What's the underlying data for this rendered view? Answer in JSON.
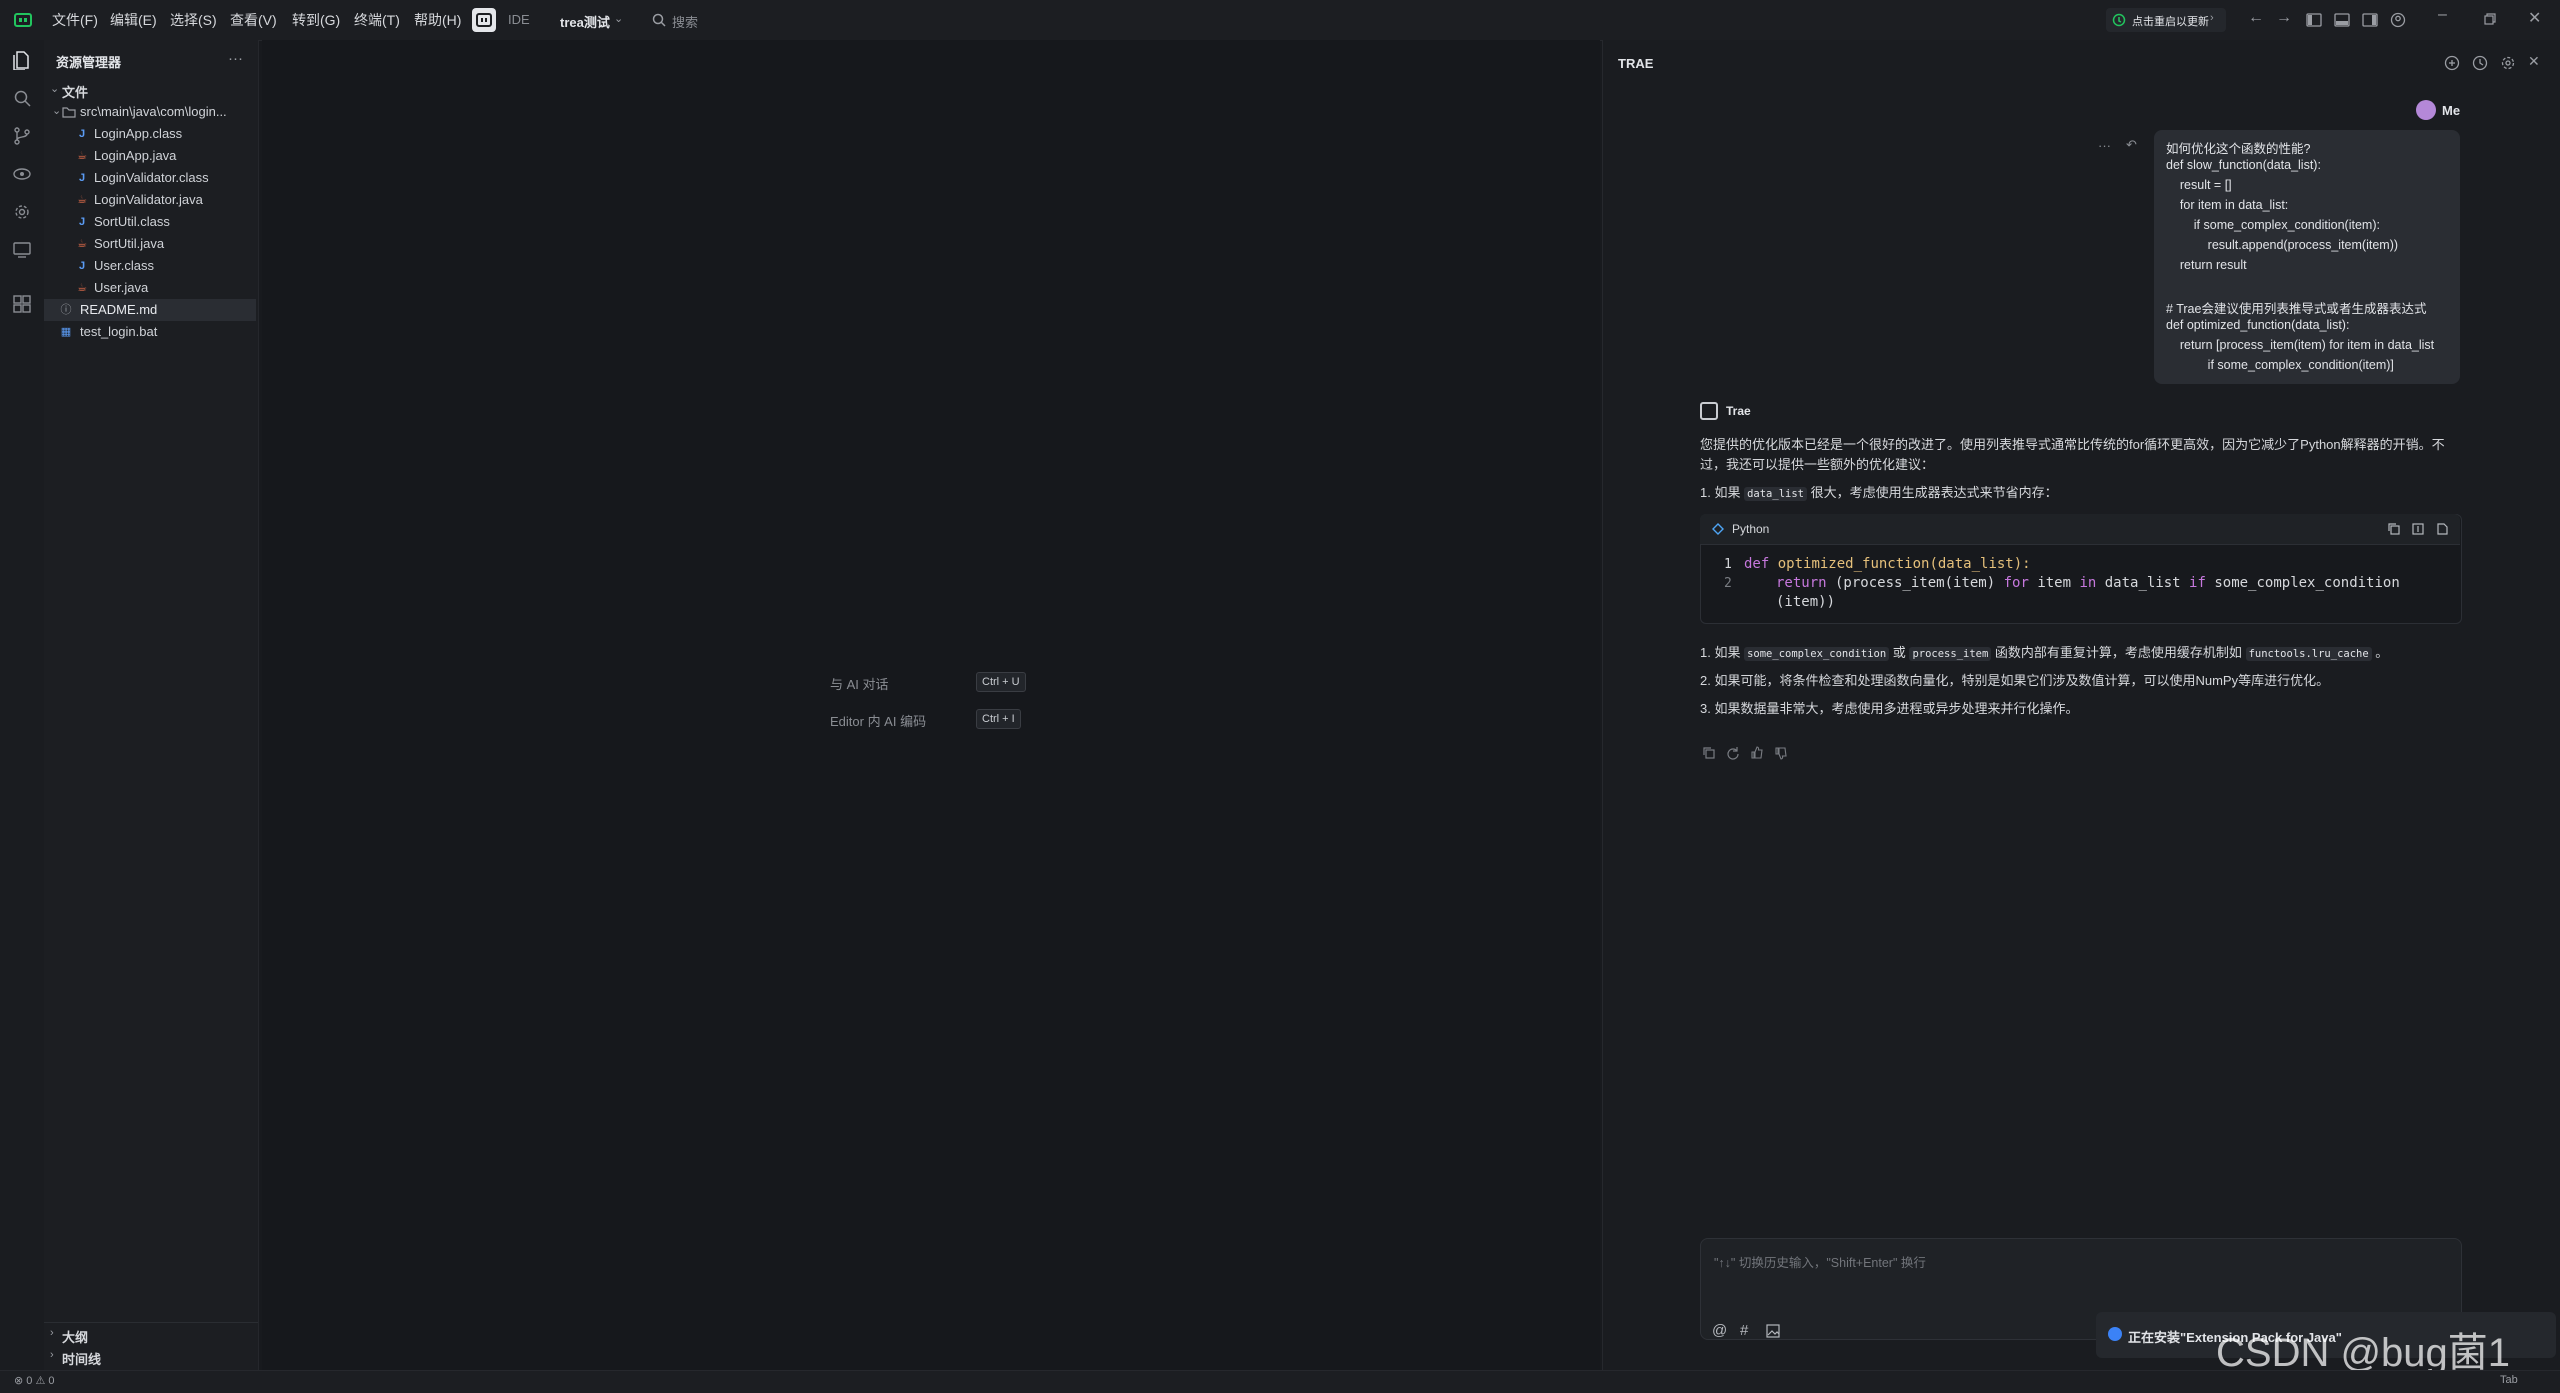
{
  "menu": {
    "items": [
      "文件(F)",
      "编辑(E)",
      "选择(S)",
      "查看(V)",
      "转到(G)",
      "终端(T)",
      "帮助(H)"
    ],
    "ide_label": "IDE",
    "project_name": "trea测试",
    "search_label": "搜索",
    "update_button": "点击重启以更新"
  },
  "sidebar": {
    "title": "资源管理器",
    "section_files": "文件",
    "folder_path": "src\\main\\java\\com\\login...",
    "files": [
      {
        "name": "LoginApp.class",
        "icon": "java-class-icon"
      },
      {
        "name": "LoginApp.java",
        "icon": "java-file-icon"
      },
      {
        "name": "LoginValidator.class",
        "icon": "java-class-icon"
      },
      {
        "name": "LoginValidator.java",
        "icon": "java-file-icon"
      },
      {
        "name": "SortUtil.class",
        "icon": "java-class-icon"
      },
      {
        "name": "SortUtil.java",
        "icon": "java-file-icon"
      },
      {
        "name": "User.class",
        "icon": "java-class-icon"
      },
      {
        "name": "User.java",
        "icon": "java-file-icon"
      }
    ],
    "root_files": [
      {
        "name": "README.md",
        "icon": "info-icon",
        "selected": true
      },
      {
        "name": "test_login.bat",
        "icon": "bat-file-icon",
        "selected": false
      }
    ],
    "section_outline": "大纲",
    "section_timeline": "时间线"
  },
  "editor": {
    "hints": [
      {
        "label": "与 AI 对话",
        "key1": "Ctrl",
        "plus": "+",
        "key2": "U"
      },
      {
        "label": "Editor 内 AI 编码",
        "key1": "Ctrl",
        "plus": "+",
        "key2": "I"
      }
    ]
  },
  "ai_panel": {
    "title": "TRAE",
    "user_name": "Me",
    "user_message_lines": [
      "如何优化这个函数的性能?",
      "def slow_function(data_list):",
      "    result = []",
      "    for item in data_list:",
      "        if some_complex_condition(item):",
      "            result.append(process_item(item))",
      "    return result",
      "",
      "# Trae会建议使用列表推导式或者生成器表达式",
      "def optimized_function(data_list):",
      "    return [process_item(item) for item in data_list",
      "            if some_complex_condition(item)]"
    ],
    "assistant_name": "Trae",
    "response_intro_1": "您提供的优化版本已经是一个很好的改进了。使用列表推导式通常比传统的for循环更高效，因为它减少了Python解释器的开销。不",
    "response_intro_2": "过，我还可以提供一些额外的优化建议：",
    "tip1_prefix": "1. 如果",
    "tip1_code": "data_list",
    "tip1_suffix": "很大，考虑使用生成器表达式来节省内存：",
    "code_lang": "Python",
    "code_line1_num": "1",
    "code_line2_num": "2",
    "code_line1_kw": "def",
    "code_line1_fn": "optimized_function",
    "code_line1_rest": "(data_list):",
    "code_line2_kw": "return",
    "code_line2_a": " (process_item(item) ",
    "code_line2_for": "for",
    "code_line2_b": " item ",
    "code_line2_in": "in",
    "code_line2_c": " data_list ",
    "code_line2_if": "if",
    "code_line2_d": " some_complex_condition",
    "code_line3": "(item))",
    "tip2_prefix": "1. 如果",
    "tip2_code1": "some_complex_condition",
    "tip2_mid": "或",
    "tip2_code2": "process_item",
    "tip2_text": "函数内部有重复计算，考虑使用缓存机制如",
    "tip2_code3": "functools.lru_cache",
    "tip2_end": "。",
    "tip3": "2. 如果可能，将条件检查和处理函数向量化，特别是如果它们涉及数值计算，可以使用NumPy等库进行优化。",
    "tip4": "3. 如果数据量非常大，考虑使用多进程或异步处理来并行化操作。",
    "input_placeholder": "\"↑↓\" 切换历史输入，\"Shift+Enter\" 换行"
  },
  "toast": {
    "text": "正在安装\"Extension Pack for Java\""
  },
  "watermark": "CSDN @bug菌1",
  "status": {
    "counts": "⊗ 0 ⚠ 0",
    "tab": "Tab"
  }
}
